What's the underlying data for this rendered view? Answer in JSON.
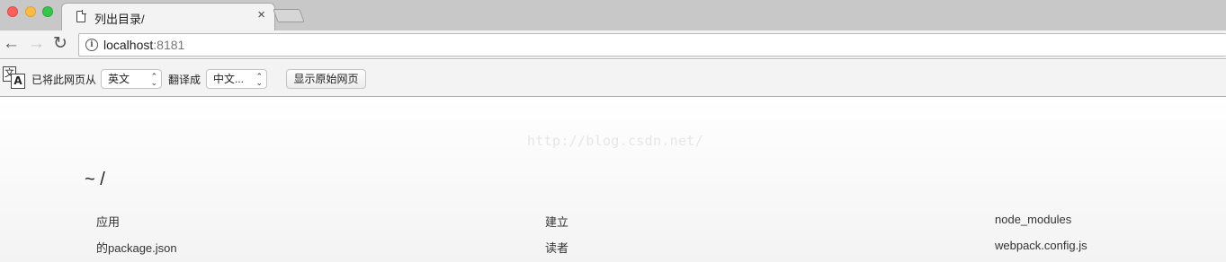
{
  "window": {
    "tab_title": "列出目录/",
    "tab_close": "×"
  },
  "toolbar": {
    "back_icon": "arrow-left",
    "forward_icon": "arrow-right",
    "reload_icon": "reload",
    "url_host": "localhost",
    "url_port": ":8181"
  },
  "translate_bar": {
    "icon_text_source": "文",
    "icon_text_target": "A",
    "label_from": "已将此网页从",
    "source_language": "英文",
    "label_to": "翻译成",
    "target_language": "中文...",
    "show_original_label": "显示原始网页"
  },
  "page": {
    "watermark": "http://blog.csdn.net/",
    "directory_heading": "~ /",
    "files": [
      [
        "应用",
        "建立",
        "node_modules"
      ],
      [
        "的package.json",
        "读者",
        "webpack.config.js"
      ]
    ]
  },
  "colors": {
    "tab_strip": "#c9c8c9",
    "toolbar": "#f3f3f3",
    "close_red": "#fc605c",
    "minimize_yellow": "#fdbc40",
    "zoom_green": "#34c84a"
  }
}
